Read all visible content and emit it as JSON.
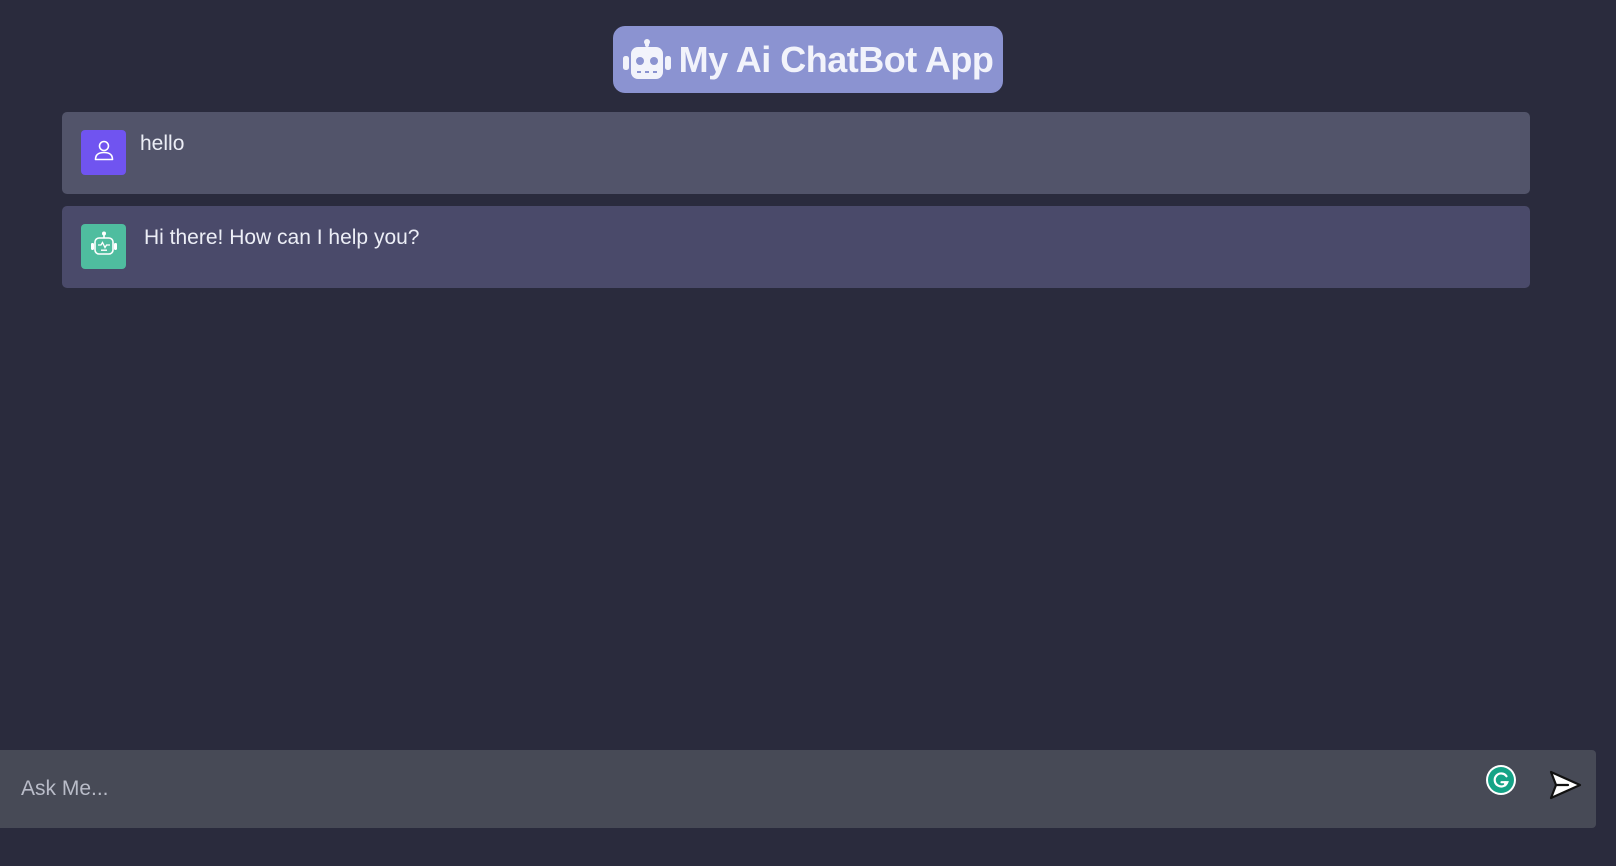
{
  "header": {
    "title": "My Ai ChatBot App",
    "logo_icon": "robot-icon",
    "background": "#8b93d1"
  },
  "messages": [
    {
      "role": "user",
      "avatar_icon": "user-icon",
      "avatar_color": "#7054f0",
      "text": "hello"
    },
    {
      "role": "bot",
      "avatar_icon": "robot-icon",
      "avatar_color": "#4fbd9f",
      "text": "Hi there! How can I help you?"
    }
  ],
  "composer": {
    "placeholder": "Ask Me...",
    "value": "",
    "grammarly_icon": "grammarly-icon",
    "send_icon": "send-icon"
  },
  "colors": {
    "page_background": "#2a2b3d",
    "user_message_background": "#52546a",
    "bot_message_background": "#4a4a6a",
    "composer_background": "#474a56"
  }
}
